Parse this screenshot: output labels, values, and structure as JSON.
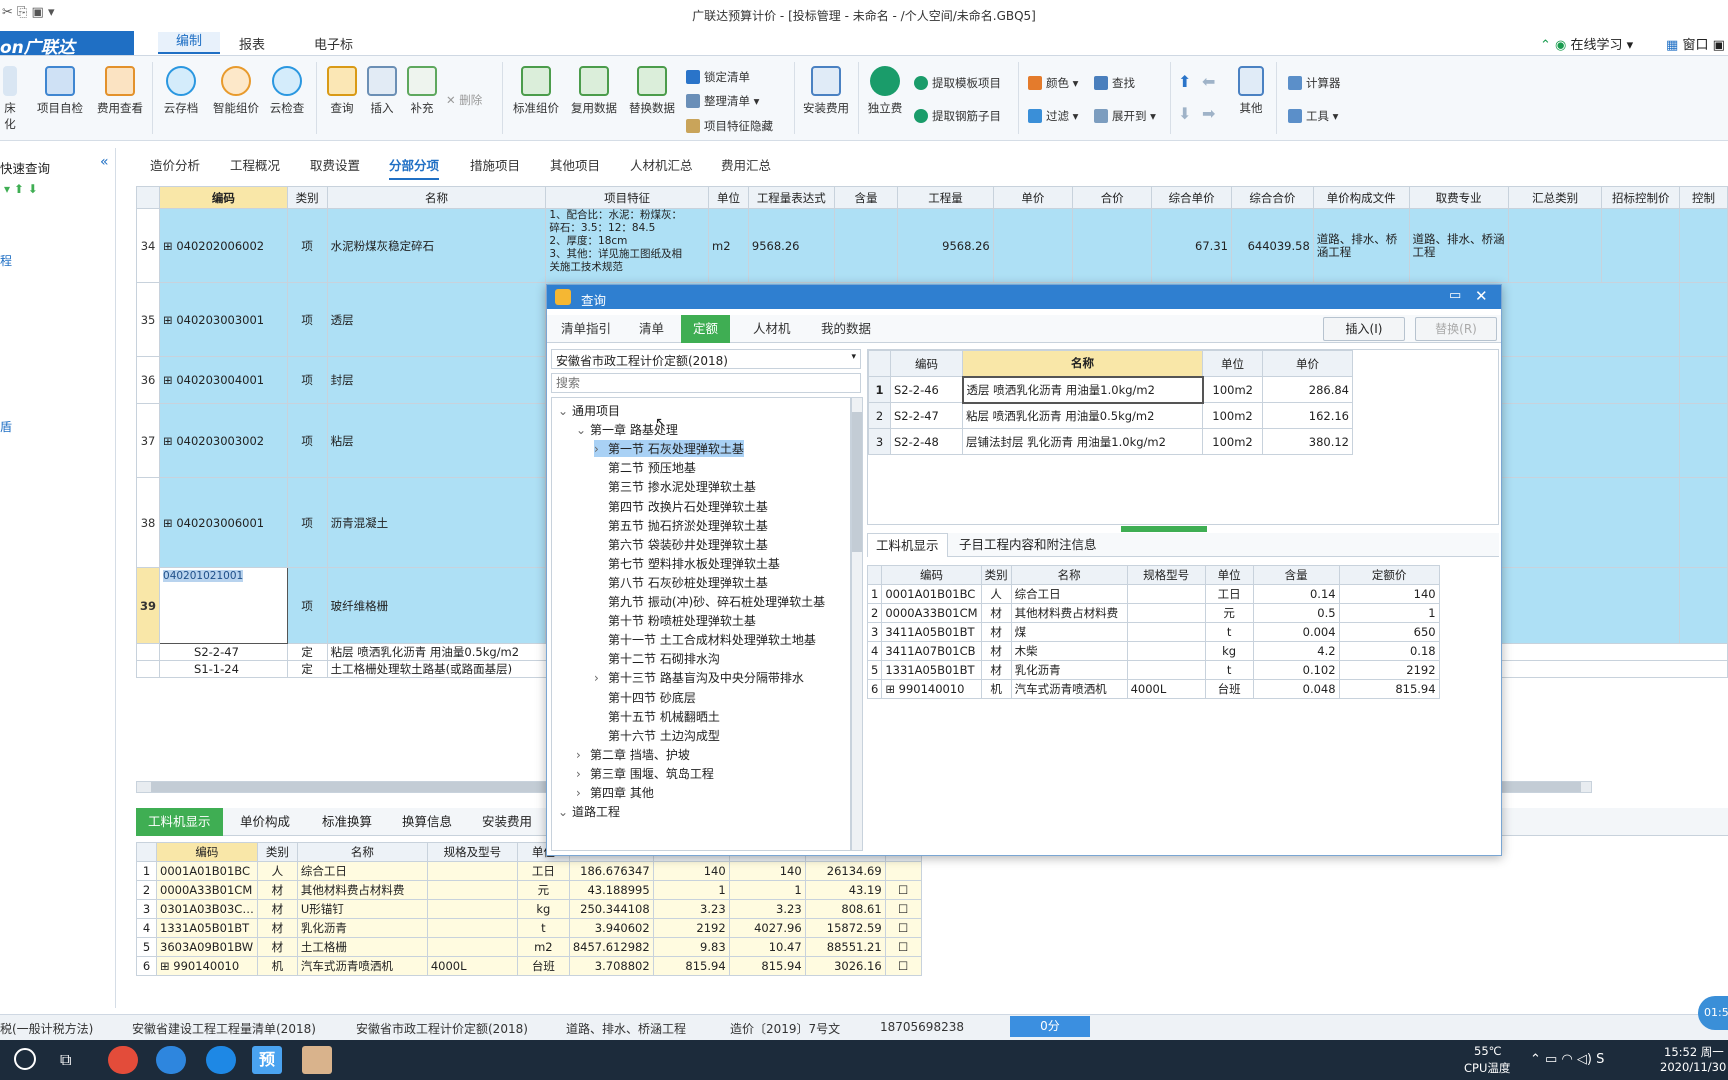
{
  "window": {
    "title": "广联达预算计价 - [投标管理 - 未命名 - /个人空间/未命名.GBQ5]"
  },
  "menu": {
    "logo": "on广联达",
    "tabs": [
      "编制",
      "报表",
      "电子标"
    ],
    "online": "在线学习",
    "window_label": "窗口"
  },
  "ribbon": {
    "left_partial": "床化",
    "big": [
      "项目自检",
      "费用查看",
      "云存档",
      "智能组价",
      "云检查",
      "查询",
      "插入",
      "补充",
      "标准组价",
      "复用数据",
      "替换数据",
      "安装费用",
      "独立费",
      "其他"
    ],
    "small": {
      "delete": "删除",
      "lock": "锁定清单",
      "arrange": "整理清单",
      "hide_feature": "项目特征隐藏",
      "extract_template": "提取模板项目",
      "extract_rebar": "提取钢筋子目",
      "color": "颜色",
      "find": "查找",
      "filter": "过滤",
      "expand": "展开到",
      "calculator": "计算器",
      "tools": "工具"
    }
  },
  "left": {
    "title": "快速查询",
    "item1": "程",
    "item2": "盾"
  },
  "subtabs": [
    "造价分析",
    "工程概况",
    "取费设置",
    "分部分项",
    "措施项目",
    "其他项目",
    "人材机汇总",
    "费用汇总"
  ],
  "grid": {
    "headers": [
      "编码",
      "类别",
      "名称",
      "项目特征",
      "单位",
      "工程量表达式",
      "含量",
      "工程量",
      "单价",
      "合价",
      "综合单价",
      "综合合价",
      "单价构成文件",
      "取费专业",
      "汇总类别",
      "招标控制价",
      "控制"
    ],
    "rows": [
      {
        "n": "34",
        "code": "040202006002",
        "type": "项",
        "name": "水泥粉煤灰稳定碎石",
        "feature": [
          "1、配合比：水泥：粉煤灰：",
          "碎石：3.5：12：84.5",
          "2、厚度：18cm",
          "3、其他：详见施工图纸及相",
          "关施工技术规范"
        ],
        "unit": "m2",
        "expr": "9568.26",
        "qty": "9568.26",
        "uprice": "67.31",
        "total": "644039.58",
        "file": "道路、排水、桥涵工程",
        "major": "道路、排水、桥涵工程"
      },
      {
        "n": "35",
        "code": "040203003001",
        "type": "项",
        "name": "透层"
      },
      {
        "n": "36",
        "code": "040203004001",
        "type": "项",
        "name": "封层"
      },
      {
        "n": "37",
        "code": "040203003002",
        "type": "项",
        "name": "粘层"
      },
      {
        "n": "38",
        "code": "040203006001",
        "type": "项",
        "name": "沥青混凝土"
      },
      {
        "n": "39",
        "code": "040201021001",
        "type": "项",
        "name": "玻纤维格栅"
      }
    ],
    "subrows": [
      {
        "code": "S2-2-47",
        "type": "定",
        "name": "粘层 喷洒乳化沥青 用油量0.5kg/m2"
      },
      {
        "code": "S1-1-24",
        "type": "定",
        "name": "土工格栅处理软土路基(或路面基层)"
      }
    ],
    "right_partial": "桥"
  },
  "dialog": {
    "title": "查询",
    "tabs": [
      "清单指引",
      "清单",
      "定额",
      "人材机",
      "我的数据"
    ],
    "insert": "插入(I)",
    "replace": "替换(R)",
    "norm": "安徽省市政工程计价定额(2018)",
    "search_placeholder": "搜索",
    "tree": [
      {
        "t": "通用项目",
        "lvl": 0,
        "exp": "v"
      },
      {
        "t": "第一章 路基处理",
        "lvl": 1,
        "exp": "v"
      },
      {
        "t": "第一节 石灰处理弹软土基",
        "lvl": 2,
        "exp": ">",
        "sel": true
      },
      {
        "t": "第二节 预压地基",
        "lvl": 2
      },
      {
        "t": "第三节 掺水泥处理弹软土基",
        "lvl": 2
      },
      {
        "t": "第四节 改换片石处理弹软土基",
        "lvl": 2
      },
      {
        "t": "第五节 抛石挤淤处理弹软土基",
        "lvl": 2
      },
      {
        "t": "第六节 袋装砂井处理弹软土基",
        "lvl": 2
      },
      {
        "t": "第七节 塑料排水板处理弹软土基",
        "lvl": 2
      },
      {
        "t": "第八节 石灰砂桩处理弹软土基",
        "lvl": 2
      },
      {
        "t": "第九节 振动(冲)砂、碎石桩处理弹软土基",
        "lvl": 2
      },
      {
        "t": "第十节 粉喷桩处理弹软土基",
        "lvl": 2
      },
      {
        "t": "第十一节 土工合成材料处理弹软土地基",
        "lvl": 2
      },
      {
        "t": "第十二节 石砌排水沟",
        "lvl": 2
      },
      {
        "t": "第十三节 路基盲沟及中央分隔带排水",
        "lvl": 2,
        "exp": ">"
      },
      {
        "t": "第十四节 砂底层",
        "lvl": 2
      },
      {
        "t": "第十五节 机械翻晒土",
        "lvl": 2
      },
      {
        "t": "第十六节 土边沟成型",
        "lvl": 2
      },
      {
        "t": "第二章 挡墙、护坡",
        "lvl": 1,
        "exp": ">"
      },
      {
        "t": "第三章 围堰、筑岛工程",
        "lvl": 1,
        "exp": ">"
      },
      {
        "t": "第四章 其他",
        "lvl": 1,
        "exp": ">"
      },
      {
        "t": "道路工程",
        "lvl": 0,
        "exp": "v"
      }
    ],
    "rtable": {
      "headers": [
        "",
        "编码",
        "名称",
        "单位",
        "单价"
      ],
      "rows": [
        [
          "1",
          "S2-2-46",
          "透层 喷洒乳化沥青 用油量1.0kg/m2",
          "100m2",
          "286.84"
        ],
        [
          "2",
          "S2-2-47",
          "粘层 喷洒乳化沥青 用油量0.5kg/m2",
          "100m2",
          "162.16"
        ],
        [
          "3",
          "S2-2-48",
          "层铺法封层 乳化沥青 用油量1.0kg/m2",
          "100m2",
          "380.12"
        ]
      ]
    },
    "btabs": [
      "工料机显示",
      "子目工程内容和附注信息"
    ],
    "btable": {
      "headers": [
        "",
        "编码",
        "类别",
        "名称",
        "规格型号",
        "单位",
        "含量",
        "定额价"
      ],
      "rows": [
        [
          "1",
          "0001A01B01BC",
          "人",
          "综合工日",
          "",
          "工日",
          "0.14",
          "140"
        ],
        [
          "2",
          "0000A33B01CM",
          "材",
          "其他材料费占材料费",
          "",
          "元",
          "0.5",
          "1"
        ],
        [
          "3",
          "3411A05B01BT",
          "材",
          "煤",
          "",
          "t",
          "0.004",
          "650"
        ],
        [
          "4",
          "3411A07B01CB",
          "材",
          "木柴",
          "",
          "kg",
          "4.2",
          "0.18"
        ],
        [
          "5",
          "1331A05B01BT",
          "材",
          "乳化沥青",
          "",
          "t",
          "0.102",
          "2192"
        ],
        [
          "6",
          "990140010",
          "机",
          "汽车式沥青喷洒机",
          "4000L",
          "台班",
          "0.048",
          "815.94"
        ]
      ]
    }
  },
  "lower": {
    "tabs": [
      "工料机显示",
      "单价构成",
      "标准换算",
      "换算信息",
      "安装费用"
    ],
    "headers": [
      "",
      "编码",
      "类别",
      "名称",
      "规格及型号",
      "单位",
      "",
      "",
      "",
      "",
      ""
    ],
    "rows": [
      [
        "1",
        "0001A01B01BC",
        "人",
        "综合工日",
        "",
        "工日",
        "186.676347",
        "140",
        "140",
        "26134.69"
      ],
      [
        "2",
        "0000A33B01CM",
        "材",
        "其他材料费占材料费",
        "",
        "元",
        "43.188995",
        "1",
        "1",
        "43.19"
      ],
      [
        "3",
        "0301A03B03C…",
        "材",
        "U形锚钉",
        "",
        "kg",
        "250.344108",
        "3.23",
        "3.23",
        "808.61"
      ],
      [
        "4",
        "1331A05B01BT",
        "材",
        "乳化沥青",
        "",
        "t",
        "3.940602",
        "2192",
        "4027.96",
        "15872.59"
      ],
      [
        "5",
        "3603A09B01BW",
        "材",
        "土工格栅",
        "",
        "m2",
        "8457.612982",
        "9.83",
        "10.47",
        "88551.21"
      ],
      [
        "6",
        "990140010",
        "机",
        "汽车式沥青喷洒机",
        "4000L",
        "台班",
        "3.708802",
        "815.94",
        "815.94",
        "3026.16"
      ]
    ]
  },
  "status": {
    "items": [
      "税(一般计税方法)",
      "安徽省建设工程工程量清单(2018)",
      "安徽省市政工程计价定额(2018)",
      "道路、排水、桥涵工程",
      "造价〔2019〕7号文",
      "18705698238"
    ],
    "progress": "0分"
  },
  "taskbar": {
    "temp": "55℃",
    "cpu": "CPU温度",
    "time": "15:52 周一",
    "date": "2020/11/30",
    "badge": "01:5"
  }
}
